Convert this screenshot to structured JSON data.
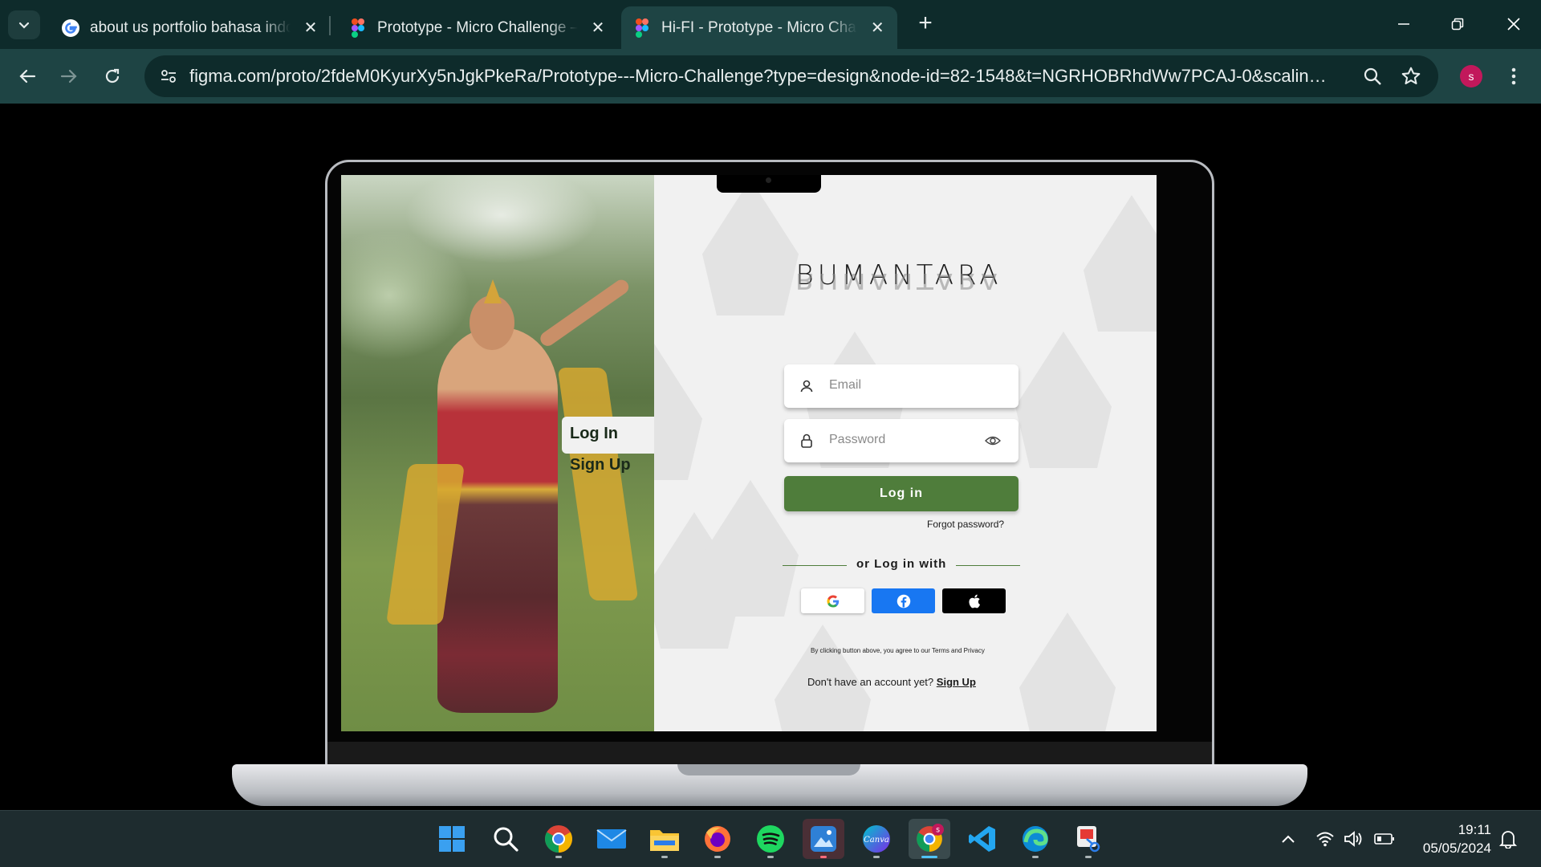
{
  "browser": {
    "tabs": [
      {
        "title": "about us portfolio bahasa indonesia",
        "favicon": "google-icon"
      },
      {
        "title": "Prototype - Micro Challenge – Figma",
        "favicon": "figma-icon"
      },
      {
        "title": "Hi-FI - Prototype - Micro Challenge",
        "favicon": "figma-icon",
        "active": true
      }
    ],
    "url": "figma.com/proto/2fdeM0KyurXy5nJgkPkeRa/Prototype---Micro-Challenge?type=design&node-id=82-1548&t=NGRHOBRhdWw7PCAJ-0&scaling=scale-d...",
    "profile_initial": "s",
    "colors": {
      "tabbar": "#0e2b2b",
      "toolbar": "#1e4444"
    }
  },
  "app": {
    "logo": "BUMANTARA",
    "side_tabs": {
      "login": "Log In",
      "signup": "Sign Up"
    },
    "email_placeholder": "Email",
    "password_placeholder": "Password",
    "login_button": "Log in",
    "forgot_password": "Forgot password?",
    "or_login_with": "or Log in with",
    "social": [
      "google-icon",
      "facebook-icon",
      "apple-icon"
    ],
    "terms": "By clicking button above, you agree to our Terms and Privacy",
    "no_account": "Don't have an account yet?",
    "signup_link": "Sign Up",
    "colors": {
      "primary": "#4f7d3b",
      "facebook": "#1877f2",
      "apple": "#000000"
    }
  },
  "taskbar": {
    "apps": [
      "windows-start-icon",
      "search-icon",
      "chrome-icon",
      "mail-icon",
      "file-explorer-icon",
      "firefox-icon",
      "spotify-icon",
      "photos-icon",
      "canva-icon",
      "chrome-profile-icon",
      "vscode-icon",
      "edge-icon",
      "snipping-tool-icon"
    ],
    "time": "19:11",
    "date": "05/05/2024"
  }
}
